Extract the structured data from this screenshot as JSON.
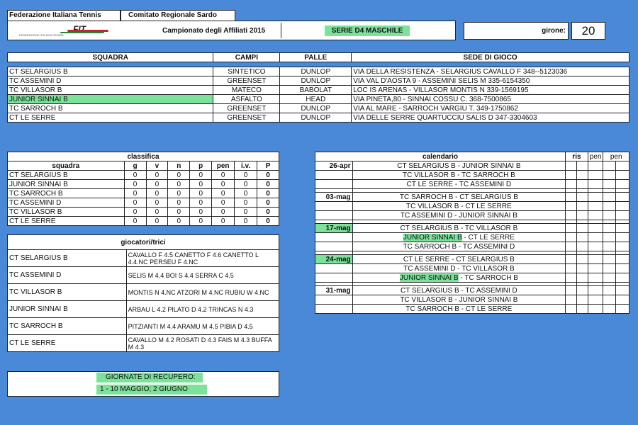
{
  "header": {
    "federazione": "Federazione Italiana Tennis",
    "comitato": "Comitato Regionale Sardo",
    "logo_text": "FIT",
    "logo_sub": "FEDERAZIONE ITALIANA TENNIS",
    "campionato": "Campionato degli Affiliati 2015",
    "serie": "SERIE D4 MASCHILE",
    "girone_label": "girone:",
    "girone_num": "20"
  },
  "squadre": {
    "columns": [
      "SQUADRA",
      "CAMPI",
      "PALLE",
      "SEDE DI GIOCO"
    ],
    "rows": [
      [
        "CT SELARGIUS B",
        "SINTETICO",
        "DUNLOP",
        "VIA DELLA RESISTENZA - SELARGIUS CAVALLO F 348--5123036"
      ],
      [
        "TC ASSEMINI D",
        "GREENSET",
        "DUNLOP",
        "VIA VAL D'AOSTA 9 - ASSEMINI SELIS M 335-6154350"
      ],
      [
        "TC VILLASOR B",
        "MATECO",
        "BABOLAT",
        "LOC IS ARENAS - VILLASOR MONTIS N 339-1569195"
      ],
      [
        "JUNIOR SINNAI B",
        "ASFALTO",
        "HEAD",
        "VIA PINETA,80 - SINNAI  COSSU C. 368-7500865"
      ],
      [
        "TC SARROCH B",
        "GREENSET",
        "DUNLOP",
        "VIA AL MARE - SARROCH  VARGIU T. 349-1750862"
      ],
      [
        "CT LE SERRE",
        "GREENSET",
        "DUNLOP",
        "VIA DELLE SERRE QUARTUCCIU SALIS D 347-3304603"
      ]
    ]
  },
  "classifica": {
    "title": "classifica",
    "columns": [
      "squadra",
      "g",
      "v",
      "n",
      "p",
      "pen",
      "i.v.",
      "P"
    ],
    "rows": [
      [
        "CT SELARGIUS B",
        "0",
        "0",
        "0",
        "0",
        "0",
        "0",
        "0"
      ],
      [
        "JUNIOR SINNAI B",
        "0",
        "0",
        "0",
        "0",
        "0",
        "0",
        "0"
      ],
      [
        "TC SARROCH B",
        "0",
        "0",
        "0",
        "0",
        "0",
        "0",
        "0"
      ],
      [
        "TC ASSEMINI D",
        "0",
        "0",
        "0",
        "0",
        "0",
        "0",
        "0"
      ],
      [
        "TC VILLASOR B",
        "0",
        "0",
        "0",
        "0",
        "0",
        "0",
        "0"
      ],
      [
        "CT LE SERRE",
        "0",
        "0",
        "0",
        "0",
        "0",
        "0",
        "0"
      ]
    ]
  },
  "giocatori": {
    "title": "giocatori/trici",
    "rows": [
      {
        "team": "CT SELARGIUS B",
        "players": "CAVALLO F 4.5 CANETTO F 4.6 CANETTO L 4.4.NC PERSEU F 4.NC"
      },
      {
        "team": "TC ASSEMINI D",
        "players": "SELIS M 4.4 BOI S 4.4 SERRA C 4.5"
      },
      {
        "team": "TC VILLASOR B",
        "players": "MONTIS N 4.NC ATZORI M 4.NC RUBIU W 4.NC"
      },
      {
        "team": "JUNIOR SINNAI B",
        "players": "ARBAU L 4.2 PILATO D 4.2 TRINCAS N 4.3"
      },
      {
        "team": "TC SARROCH B",
        "players": "PITZIANTI M 4.4 ARAMU M 4.5 PIBIA D 4.5"
      },
      {
        "team": "CT LE SERRE",
        "players": "CAVALLO M 4.2 ROSATI D 4.3 FAIS M 4.3 BUFFA M 4.3"
      }
    ]
  },
  "recupero": {
    "title": "GIORNATE DI RECUPERO:",
    "dates": "1 - 10 MAGGIO;  2 GIUGNO"
  },
  "calendario": {
    "title": "calendario",
    "col_ris": "ris",
    "col_pen1": "pen",
    "col_pen2": "pen",
    "rounds": [
      {
        "date": "26-apr",
        "matches": [
          {
            "home": "CT SELARGIUS B",
            "away": "JUNIOR SINNAI B"
          },
          {
            "home": "TC VILLASOR B",
            "away": "TC SARROCH B"
          },
          {
            "home": "CT LE SERRE",
            "away": "TC ASSEMINI D"
          }
        ]
      },
      {
        "date": "03-mag",
        "matches": [
          {
            "home": "TC SARROCH B",
            "away": "CT SELARGIUS B"
          },
          {
            "home": "TC VILLASOR B",
            "away": "CT LE SERRE"
          },
          {
            "home": "TC ASSEMINI D",
            "away": "JUNIOR SINNAI B"
          }
        ]
      },
      {
        "date": "17-mag",
        "matches": [
          {
            "home": "CT SELARGIUS B",
            "away": "TC VILLASOR B"
          },
          {
            "home": "JUNIOR SINNAI B",
            "away": "CT LE SERRE"
          },
          {
            "home": "TC SARROCH B",
            "away": "TC ASSEMINI D"
          }
        ]
      },
      {
        "date": "24-mag",
        "matches": [
          {
            "home": "CT LE SERRE",
            "away": "CT SELARGIUS B"
          },
          {
            "home": "TC ASSEMINI D",
            "away": "TC VILLASOR B"
          },
          {
            "home": "JUNIOR SINNAI B",
            "away": "TC SARROCH B"
          }
        ]
      },
      {
        "date": "31-mag",
        "matches": [
          {
            "home": "CT SELARGIUS B",
            "away": "TC ASSEMINI D"
          },
          {
            "home": "TC VILLASOR B",
            "away": "JUNIOR SINNAI B"
          },
          {
            "home": "TC SARROCH B",
            "away": "CT LE SERRE"
          }
        ]
      }
    ]
  },
  "colors": {
    "background": "#4a89d8",
    "highlight": "#7ce29a",
    "panel": "#ffffff"
  }
}
